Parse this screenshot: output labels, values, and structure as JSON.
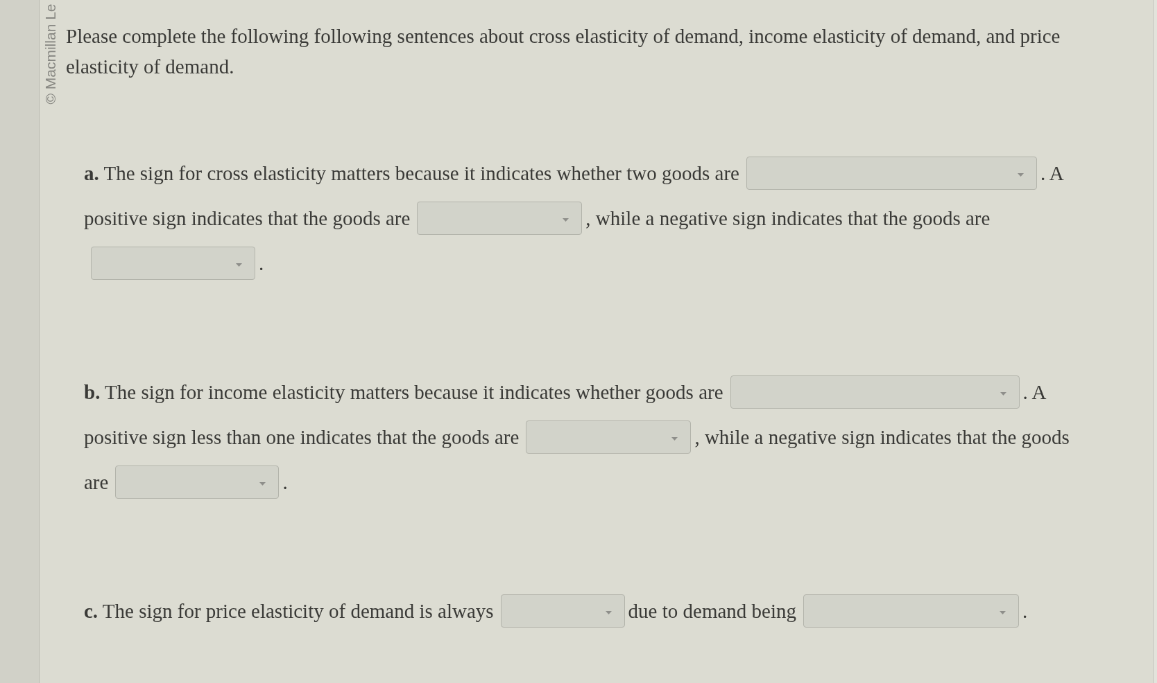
{
  "copyright": "© Macmillan Le",
  "instructions": "Please complete the following following sentences about cross elasticity of demand, income elasticity of demand, and price elasticity of demand.",
  "questions": [
    {
      "lines": [
        [
          {
            "kind": "text",
            "text": "**a.** The sign for cross elasticity matters because it indicates whether two goods are"
          },
          {
            "kind": "dropdown"
          },
          {
            "kind": "text",
            "text": ". A"
          }
        ],
        [
          {
            "kind": "text",
            "text": "positive sign indicates that the goods are"
          },
          {
            "kind": "dropdown"
          },
          {
            "kind": "text",
            "text": ", while a negative sign indicates that the goods are"
          }
        ],
        [
          {
            "kind": "dropdown"
          },
          {
            "kind": "text",
            "text": "."
          }
        ]
      ]
    },
    {
      "lines": [
        [
          {
            "kind": "text",
            "text": "**b.** The sign for income elasticity matters because it indicates whether goods are"
          },
          {
            "kind": "dropdown"
          },
          {
            "kind": "text",
            "text": ". A"
          }
        ],
        [
          {
            "kind": "text",
            "text": "positive sign less than one indicates that the goods are"
          },
          {
            "kind": "dropdown"
          },
          {
            "kind": "text",
            "text": ", while a negative sign indicates that the goods"
          }
        ],
        [
          {
            "kind": "text",
            "text": "are"
          },
          {
            "kind": "dropdown"
          },
          {
            "kind": "text",
            "text": "."
          }
        ]
      ]
    },
    {
      "lines": [
        [
          {
            "kind": "text",
            "text": "**c.** The sign for price elasticity of demand is always"
          },
          {
            "kind": "dropdown"
          },
          {
            "kind": "text",
            "text": "due to demand being"
          },
          {
            "kind": "dropdown"
          },
          {
            "kind": "text",
            "text": "."
          }
        ]
      ]
    }
  ]
}
